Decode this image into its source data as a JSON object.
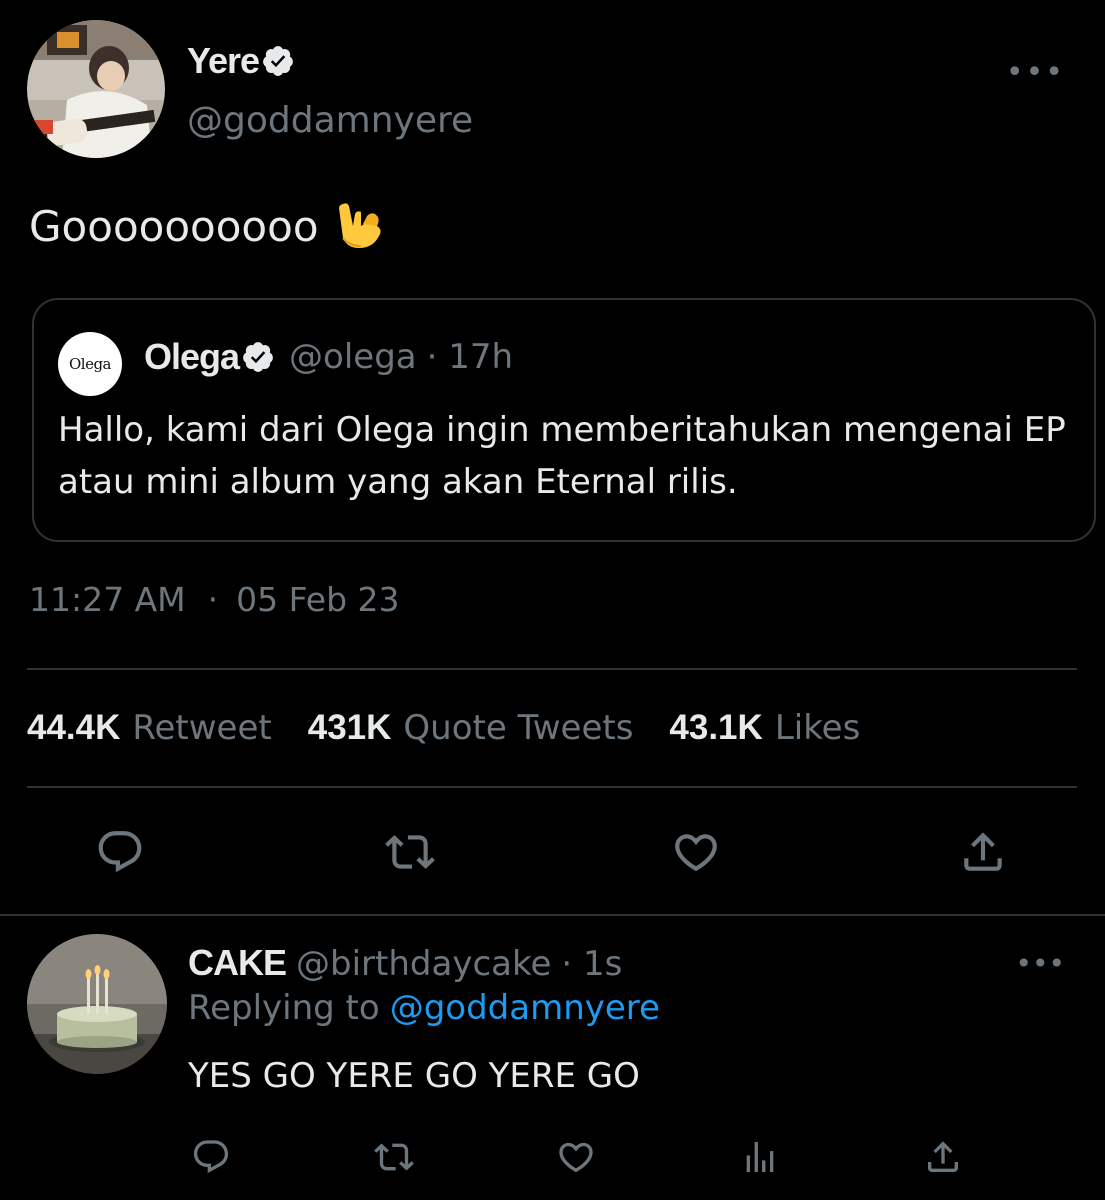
{
  "tweet": {
    "author": {
      "display_name": "Yere",
      "handle": "@goddamnyere",
      "verified": true
    },
    "text": "Goooooooooo",
    "emoji": "🤟",
    "more_icon": "more-dots-icon",
    "quoted": {
      "author_name": "Olega",
      "avatar_text": "Olega",
      "handle": "@olega",
      "time_ago": "· 17h",
      "text": "Hallo, kami dari Olega ingin memberitahukan mengenai EP atau mini album yang akan Eternal rilis."
    },
    "time": "11:27 AM",
    "separator": "·",
    "date": "05 Feb 23",
    "stats": {
      "retweets": "44.4K",
      "retweets_label": "Retweet",
      "quotes": "431K",
      "quotes_label": "Quote Tweets",
      "likes": "43.1K",
      "likes_label": "Likes"
    },
    "actions": [
      "reply-icon",
      "retweet-icon",
      "like-icon",
      "share-icon"
    ]
  },
  "reply": {
    "display_name": "CAKE",
    "handle": "@birthdaycake",
    "time_ago": "· 1s",
    "replying_prefix": "Replying to",
    "replying_to": "@goddamnyere",
    "text": "YES GO YERE GO YERE GO",
    "actions": [
      "reply-icon",
      "retweet-icon",
      "like-icon",
      "analytics-icon",
      "share-icon"
    ]
  },
  "colors": {
    "background": "#000000",
    "text_primary": "#e7e9ea",
    "text_secondary": "#6e767d",
    "border": "#2f3336",
    "link": "#1d9bf0"
  }
}
